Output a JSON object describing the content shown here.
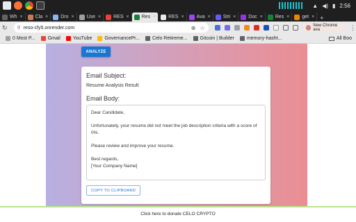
{
  "os": {
    "time": "2:56"
  },
  "tabs": [
    {
      "label": "Wh",
      "color": "#5f6368",
      "active": false
    },
    {
      "label": "Cla",
      "color": "#c57b57",
      "active": false
    },
    {
      "label": "Dro",
      "color": "#8ab4f8",
      "active": false
    },
    {
      "label": "Use",
      "color": "#9aa0a6",
      "active": false
    },
    {
      "label": "RES",
      "color": "#ea4335",
      "active": false
    },
    {
      "label": "Res",
      "color": "#188038",
      "active": true
    },
    {
      "label": "RES",
      "color": "#e8eaed",
      "active": false
    },
    {
      "label": "Ava",
      "color": "#a142f4",
      "active": false
    },
    {
      "label": "Stri",
      "color": "#635bff",
      "active": false
    },
    {
      "label": "Doc",
      "color": "#9334e6",
      "active": false
    },
    {
      "label": "Res",
      "color": "#188038",
      "active": false
    },
    {
      "label": "get",
      "color": "#ea8600",
      "active": false
    }
  ],
  "address_bar": {
    "url": "reso-cfy5.onrender.com",
    "profile_label": "New Chrome ava"
  },
  "bookmarks": {
    "items": [
      {
        "label": "0 Most P...",
        "color": "#9aa0a6"
      },
      {
        "label": "Gmail",
        "color": "#ea4335"
      },
      {
        "label": "YouTube",
        "color": "#ff0000"
      },
      {
        "label": "GovernancePr...",
        "color": "#fbbc04"
      },
      {
        "label": "Celo Retireme...",
        "color": "#5f6368"
      },
      {
        "label": "Gitcoin | Builder",
        "color": "#5f6368"
      },
      {
        "label": "memory-hasht...",
        "color": "#5f6368"
      }
    ],
    "all_label": "All Boo"
  },
  "main": {
    "analyze_label": "ANALYZE",
    "subject_heading": "Email Subject:",
    "subject_value": "Resume Analysis Result",
    "body_heading": "Email Body:",
    "body_lines": [
      "Dear Candidate,",
      "Unfortunately, your resume did not meet the job description criteria with a score of 0%.",
      "Please review and improve your resume.",
      "Best regards,",
      "[Your Company Name]"
    ],
    "copy_label": "COPY TO CLIPBOARD"
  },
  "footer": {
    "donate_text": "Click here to donate CELO CRYPTO"
  },
  "colors": {
    "accent": "#1976d2",
    "gradient_left": "#b7b0e2",
    "gradient_right": "#eb8e93"
  }
}
